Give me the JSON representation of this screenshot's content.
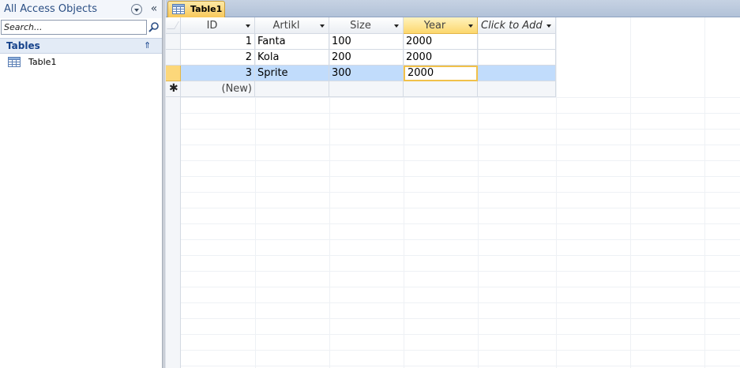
{
  "nav": {
    "title": "All Access Objects",
    "collapse_glyph": "«",
    "search": {
      "placeholder": "Search..."
    },
    "group": {
      "label": "Tables",
      "collapse_glyph": "⇑"
    },
    "items": [
      {
        "label": "Table1",
        "icon": "table-icon"
      }
    ]
  },
  "tabs": [
    {
      "label": "Table1",
      "icon": "table-icon",
      "active": true
    }
  ],
  "grid": {
    "columns": [
      {
        "label": "ID",
        "align": "right"
      },
      {
        "label": "Artikl",
        "align": "left"
      },
      {
        "label": "Size",
        "align": "left"
      },
      {
        "label": "Year",
        "align": "left",
        "active": true
      },
      {
        "label": "Click to Add",
        "add": true
      }
    ],
    "rows": [
      {
        "ID": "1",
        "Artikl": "Fanta",
        "Size": "100",
        "Year": "2000"
      },
      {
        "ID": "2",
        "Artikl": "Kola",
        "Size": "200",
        "Year": "2000"
      },
      {
        "ID": "3",
        "Artikl": "Sprite",
        "Size": "300",
        "Year": "2000",
        "current": true
      }
    ],
    "new_row": {
      "marker": "✱",
      "label": "(New)"
    }
  },
  "colors": {
    "accent_selection": "#c1dcfc",
    "active_header": "#fcd76d",
    "tab_active": "#f8c85a",
    "nav_title": "#2b4f84"
  }
}
